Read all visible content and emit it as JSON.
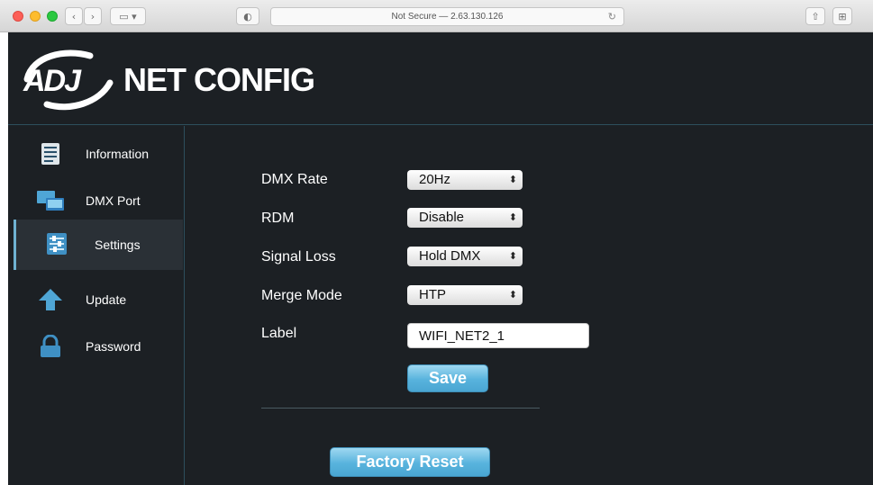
{
  "browser": {
    "address": "Not Secure — 2.63.130.126"
  },
  "app": {
    "brand": "ADJ",
    "title": "NET CONFIG"
  },
  "sidebar": {
    "items": [
      {
        "label": "Information",
        "icon": "document-icon"
      },
      {
        "label": "DMX Port",
        "icon": "monitor-icon"
      },
      {
        "label": "Settings",
        "icon": "settings-icon",
        "active": true
      },
      {
        "label": "Update",
        "icon": "up-arrow-icon"
      },
      {
        "label": "Password",
        "icon": "lock-icon"
      }
    ]
  },
  "settings": {
    "dmx_rate": {
      "label": "DMX Rate",
      "value": "20Hz"
    },
    "rdm": {
      "label": "RDM",
      "value": "Disable"
    },
    "signal_loss": {
      "label": "Signal Loss",
      "value": "Hold DMX"
    },
    "merge_mode": {
      "label": "Merge Mode",
      "value": "HTP"
    },
    "label_field": {
      "label": "Label",
      "value": "WIFI_NET2_1"
    },
    "save_label": "Save",
    "factory_reset_label": "Factory Reset"
  },
  "colors": {
    "background": "#1c2024",
    "accent": "#58b3dd",
    "divider": "#2d4f5d"
  }
}
